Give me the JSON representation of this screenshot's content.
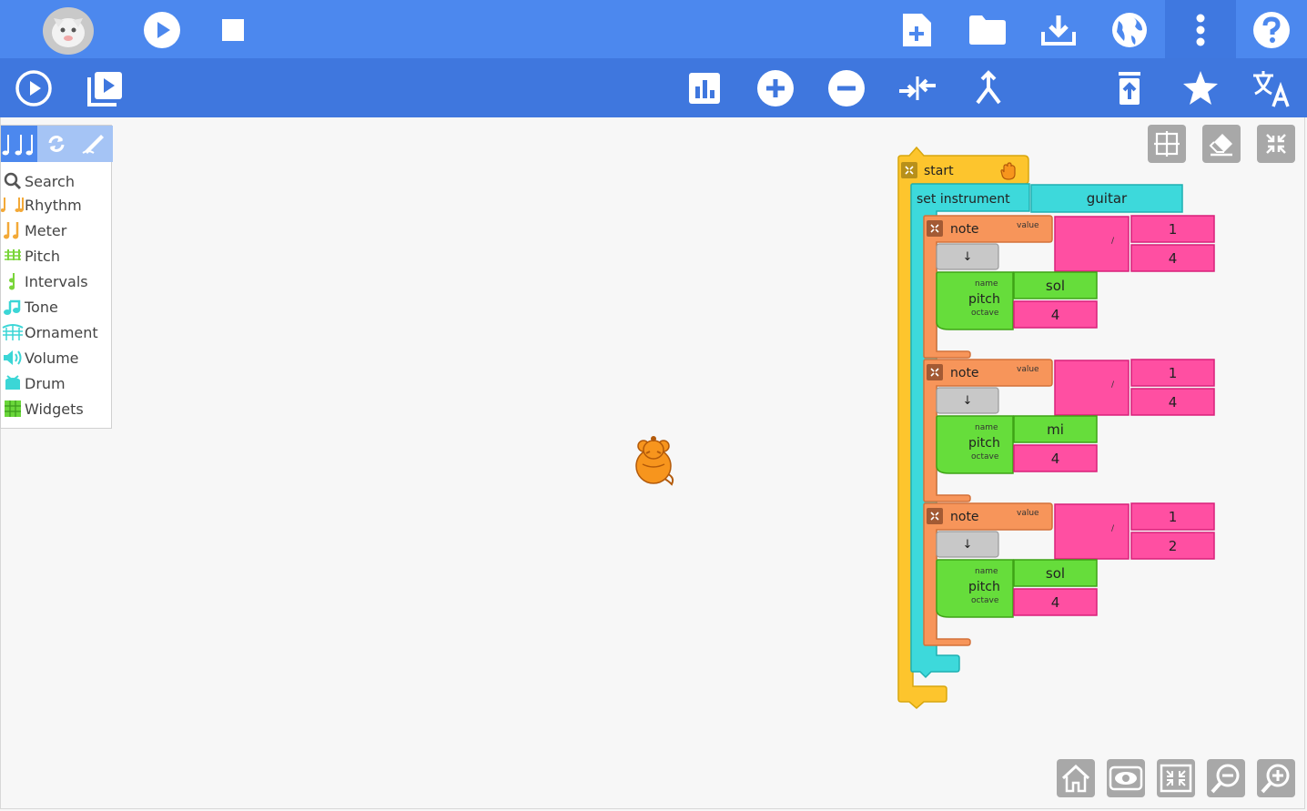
{
  "toolbar_top": {
    "buttons": [
      "play-icon",
      "stop-icon",
      "new-project-icon",
      "load-project-icon",
      "save-project-icon",
      "planet-icon",
      "more-menu-icon",
      "help-icon"
    ]
  },
  "toolbar_second": {
    "buttons": [
      "run-slowly-icon",
      "run-step-icon",
      "statistics-icon",
      "enlarge-blocks-icon",
      "shrink-blocks-icon",
      "collapse-blocks-icon",
      "merge-icon",
      "restore-trash-icon",
      "favorites-icon",
      "language-icon"
    ]
  },
  "palette": {
    "items": [
      {
        "label": "Search",
        "color": "#666666"
      },
      {
        "label": "Rhythm",
        "color": "#f3a938"
      },
      {
        "label": "Meter",
        "color": "#f3a938"
      },
      {
        "label": "Pitch",
        "color": "#7ad53a"
      },
      {
        "label": "Intervals",
        "color": "#7ad53a"
      },
      {
        "label": "Tone",
        "color": "#3bd6d6"
      },
      {
        "label": "Ornament",
        "color": "#3bd6d6"
      },
      {
        "label": "Volume",
        "color": "#3bd6d6"
      },
      {
        "label": "Drum",
        "color": "#3bd6d6"
      },
      {
        "label": "Widgets",
        "color": "#6ad63a"
      }
    ]
  },
  "program": {
    "start_label": "start",
    "set_instrument_label": "set instrument",
    "instrument_value": "guitar",
    "note_label": "note",
    "value_label": "value",
    "divide_symbol": "/",
    "rest_symbol": "↓",
    "pitch_label": "pitch",
    "name_label": "name",
    "octave_label": "octave",
    "notes": [
      {
        "numerator": "1",
        "denominator": "4",
        "pitch_name": "sol",
        "octave": "4"
      },
      {
        "numerator": "1",
        "denominator": "4",
        "pitch_name": "mi",
        "octave": "4"
      },
      {
        "numerator": "1",
        "denominator": "2",
        "pitch_name": "sol",
        "octave": "4"
      }
    ]
  },
  "colors": {
    "toolbar": "#4c88ee",
    "toolbar_secondary": "#3f77de",
    "start_block": "#fdc52d",
    "instrument_block": "#3dd9db",
    "note_block": "#f7955a",
    "number_block": "#ff4fa2",
    "pitch_block": "#66dd3b",
    "rest_block": "#c8c8c8"
  }
}
